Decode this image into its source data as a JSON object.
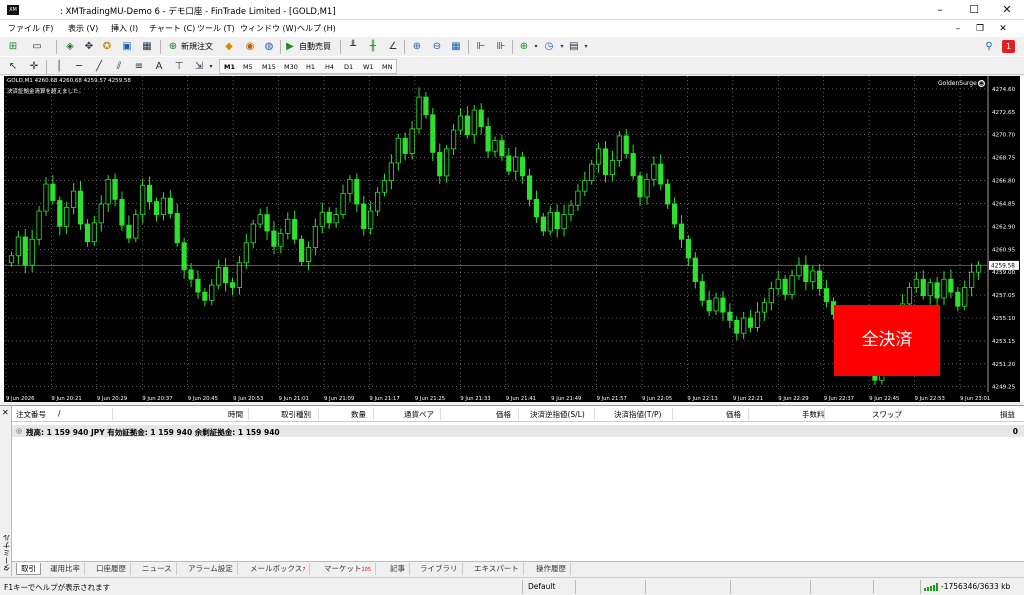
{
  "window": {
    "title": ": XMTradingMU-Demo 6 - デモ口座 - FinTrade Limited - [GOLD,M1]",
    "app_icon_text": "XM",
    "minimize": "–",
    "maximize": "☐",
    "close": "✕"
  },
  "menu": {
    "items": [
      "ファイル (F)",
      "表示 (V)",
      "挿入 (I)",
      "チャート (C)",
      "ツール (T)",
      "ウィンドウ (W)",
      "ヘルプ (H)"
    ],
    "mdi_minimize": "–",
    "mdi_restore": "❐",
    "mdi_close": "✕"
  },
  "toolbar": {
    "new_order_label": "新規注文",
    "auto_trading_label": "自動売買",
    "timeframes": [
      "M1",
      "M5",
      "M15",
      "M30",
      "H1",
      "H4",
      "D1",
      "W1",
      "MN"
    ],
    "active_timeframe": "M1",
    "notification_count": "1"
  },
  "chart": {
    "info_line": "GOLD,M1  4260.68 4260.68 4259.57 4259.58",
    "warning_line": "決済証拠金清算を超えました。",
    "ea_name": "GoldenSurge",
    "ea_face": "☺",
    "close_all_label": "全決済",
    "current_price_label": "4259.58",
    "colors": {
      "background": "#000000",
      "grid": "#9a9a9a",
      "bull": "#2fe02f",
      "bear": "#2fe02f",
      "text": "#ffffff",
      "close_all_bg": "#ff0000"
    }
  },
  "chart_data": {
    "type": "candlestick",
    "symbol": "GOLD",
    "timeframe": "M1",
    "ylim": [
      4248.8,
      4275.7
    ],
    "y_ticks": [
      "4274.60",
      "4272.65",
      "4270.70",
      "4268.75",
      "4266.80",
      "4264.85",
      "4262.90",
      "4260.95",
      "4259.00",
      "4257.05",
      "4255.10",
      "4253.15",
      "4251.20",
      "4249.25"
    ],
    "x_ticks": [
      "9 Jun 2026",
      "9 Jun 20:21",
      "9 Jun 20:29",
      "9 Jun 20:37",
      "9 Jun 20:45",
      "9 Jun 20:53",
      "9 Jun 21:01",
      "9 Jun 21:09",
      "9 Jun 21:17",
      "9 Jun 21:25",
      "9 Jun 21:33",
      "9 Jun 21:41",
      "9 Jun 21:49",
      "9 Jun 21:57",
      "9 Jun 22:05",
      "9 Jun 22:13",
      "9 Jun 22:21",
      "9 Jun 22:29",
      "9 Jun 22:37",
      "9 Jun 22:45",
      "9 Jun 22:53",
      "9 Jun 23:01"
    ],
    "closes": [
      4260.4,
      4262.0,
      4259.6,
      4261.8,
      4264.2,
      4266.5,
      4265.1,
      4262.9,
      4264.5,
      4265.9,
      4263.1,
      4261.6,
      4263.2,
      4264.8,
      4266.9,
      4265.2,
      4263.0,
      4261.9,
      4263.9,
      4266.4,
      4265.0,
      4263.9,
      4265.3,
      4264.0,
      4261.5,
      4259.2,
      4258.4,
      4257.3,
      4256.6,
      4257.9,
      4259.4,
      4258.1,
      4257.7,
      4259.8,
      4261.5,
      4263.1,
      4263.9,
      4262.5,
      4261.2,
      4262.3,
      4263.5,
      4261.8,
      4259.9,
      4261.1,
      4262.9,
      4264.1,
      4263.2,
      4263.9,
      4265.7,
      4266.9,
      4264.8,
      4262.7,
      4264.2,
      4265.8,
      4266.8,
      4268.3,
      4270.4,
      4269.1,
      4271.2,
      4273.9,
      4272.4,
      4269.2,
      4267.2,
      4269.5,
      4271.1,
      4272.3,
      4270.7,
      4272.8,
      4271.4,
      4269.3,
      4270.2,
      4268.9,
      4267.6,
      4268.8,
      4267.2,
      4265.2,
      4263.7,
      4262.5,
      4264.1,
      4262.7,
      4263.9,
      4264.7,
      4265.9,
      4266.8,
      4268.2,
      4269.5,
      4267.3,
      4268.5,
      4270.6,
      4269.1,
      4267.2,
      4265.4,
      4266.9,
      4268.2,
      4266.5,
      4264.8,
      4263.1,
      4261.8,
      4260.2,
      4258.2,
      4256.6,
      4255.7,
      4256.8,
      4255.6,
      4254.9,
      4253.8,
      4255.1,
      4254.3,
      4255.6,
      4256.4,
      4257.6,
      4258.4,
      4257.1,
      4258.7,
      4259.6,
      4258.2,
      4259.1,
      4257.6,
      4256.5,
      4255.4,
      4254.2,
      4252.6,
      4252.0,
      4252.9,
      4251.4,
      4249.8,
      4251.6,
      4253.7,
      4254.7,
      4256.3,
      4257.7,
      4258.4,
      4257.0,
      4258.1,
      4256.8,
      4258.4,
      4257.3,
      4256.1,
      4257.7,
      4259.0,
      4259.6
    ]
  },
  "terminal": {
    "label": "ターミナル",
    "close_icon": "✕",
    "columns": [
      "注文番号",
      "/",
      "時間",
      "取引種別",
      "数量",
      "通貨ペア",
      "価格",
      "決済逆指値(S/L)",
      "決済指値(T/P)",
      "価格",
      "手数料",
      "スワップ",
      "損益"
    ],
    "balance_text": "残高: 1 159 940 JPY  有効証拠金: 1 159 940  余剰証拠金: 1 159 940",
    "balance_profit": "0",
    "tabs": [
      {
        "label": "取引",
        "badge": ""
      },
      {
        "label": "運用比率",
        "badge": ""
      },
      {
        "label": "口座履歴",
        "badge": ""
      },
      {
        "label": "ニュース",
        "badge": ""
      },
      {
        "label": "アラーム設定",
        "badge": ""
      },
      {
        "label": "メールボックス",
        "badge": "7"
      },
      {
        "label": "マーケット",
        "badge": "105"
      },
      {
        "label": "記事",
        "badge": ""
      },
      {
        "label": "ライブラリ",
        "badge": ""
      },
      {
        "label": "エキスパート",
        "badge": ""
      },
      {
        "label": "操作履歴",
        "badge": ""
      }
    ]
  },
  "status": {
    "help": "F1キーでヘルプが表示されます",
    "profile": "Default",
    "connection": "-1756346/3633 kb"
  }
}
